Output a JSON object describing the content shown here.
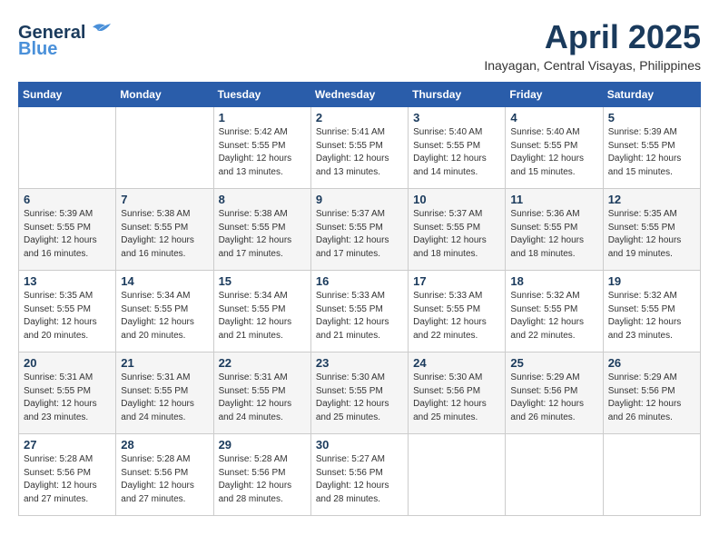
{
  "logo": {
    "line1": "General",
    "line2": "Blue"
  },
  "title": "April 2025",
  "location": "Inayagan, Central Visayas, Philippines",
  "days_of_week": [
    "Sunday",
    "Monday",
    "Tuesday",
    "Wednesday",
    "Thursday",
    "Friday",
    "Saturday"
  ],
  "weeks": [
    [
      {
        "day": "",
        "info": ""
      },
      {
        "day": "",
        "info": ""
      },
      {
        "day": "1",
        "info": "Sunrise: 5:42 AM\nSunset: 5:55 PM\nDaylight: 12 hours and 13 minutes."
      },
      {
        "day": "2",
        "info": "Sunrise: 5:41 AM\nSunset: 5:55 PM\nDaylight: 12 hours and 13 minutes."
      },
      {
        "day": "3",
        "info": "Sunrise: 5:40 AM\nSunset: 5:55 PM\nDaylight: 12 hours and 14 minutes."
      },
      {
        "day": "4",
        "info": "Sunrise: 5:40 AM\nSunset: 5:55 PM\nDaylight: 12 hours and 15 minutes."
      },
      {
        "day": "5",
        "info": "Sunrise: 5:39 AM\nSunset: 5:55 PM\nDaylight: 12 hours and 15 minutes."
      }
    ],
    [
      {
        "day": "6",
        "info": "Sunrise: 5:39 AM\nSunset: 5:55 PM\nDaylight: 12 hours and 16 minutes."
      },
      {
        "day": "7",
        "info": "Sunrise: 5:38 AM\nSunset: 5:55 PM\nDaylight: 12 hours and 16 minutes."
      },
      {
        "day": "8",
        "info": "Sunrise: 5:38 AM\nSunset: 5:55 PM\nDaylight: 12 hours and 17 minutes."
      },
      {
        "day": "9",
        "info": "Sunrise: 5:37 AM\nSunset: 5:55 PM\nDaylight: 12 hours and 17 minutes."
      },
      {
        "day": "10",
        "info": "Sunrise: 5:37 AM\nSunset: 5:55 PM\nDaylight: 12 hours and 18 minutes."
      },
      {
        "day": "11",
        "info": "Sunrise: 5:36 AM\nSunset: 5:55 PM\nDaylight: 12 hours and 18 minutes."
      },
      {
        "day": "12",
        "info": "Sunrise: 5:35 AM\nSunset: 5:55 PM\nDaylight: 12 hours and 19 minutes."
      }
    ],
    [
      {
        "day": "13",
        "info": "Sunrise: 5:35 AM\nSunset: 5:55 PM\nDaylight: 12 hours and 20 minutes."
      },
      {
        "day": "14",
        "info": "Sunrise: 5:34 AM\nSunset: 5:55 PM\nDaylight: 12 hours and 20 minutes."
      },
      {
        "day": "15",
        "info": "Sunrise: 5:34 AM\nSunset: 5:55 PM\nDaylight: 12 hours and 21 minutes."
      },
      {
        "day": "16",
        "info": "Sunrise: 5:33 AM\nSunset: 5:55 PM\nDaylight: 12 hours and 21 minutes."
      },
      {
        "day": "17",
        "info": "Sunrise: 5:33 AM\nSunset: 5:55 PM\nDaylight: 12 hours and 22 minutes."
      },
      {
        "day": "18",
        "info": "Sunrise: 5:32 AM\nSunset: 5:55 PM\nDaylight: 12 hours and 22 minutes."
      },
      {
        "day": "19",
        "info": "Sunrise: 5:32 AM\nSunset: 5:55 PM\nDaylight: 12 hours and 23 minutes."
      }
    ],
    [
      {
        "day": "20",
        "info": "Sunrise: 5:31 AM\nSunset: 5:55 PM\nDaylight: 12 hours and 23 minutes."
      },
      {
        "day": "21",
        "info": "Sunrise: 5:31 AM\nSunset: 5:55 PM\nDaylight: 12 hours and 24 minutes."
      },
      {
        "day": "22",
        "info": "Sunrise: 5:31 AM\nSunset: 5:55 PM\nDaylight: 12 hours and 24 minutes."
      },
      {
        "day": "23",
        "info": "Sunrise: 5:30 AM\nSunset: 5:55 PM\nDaylight: 12 hours and 25 minutes."
      },
      {
        "day": "24",
        "info": "Sunrise: 5:30 AM\nSunset: 5:56 PM\nDaylight: 12 hours and 25 minutes."
      },
      {
        "day": "25",
        "info": "Sunrise: 5:29 AM\nSunset: 5:56 PM\nDaylight: 12 hours and 26 minutes."
      },
      {
        "day": "26",
        "info": "Sunrise: 5:29 AM\nSunset: 5:56 PM\nDaylight: 12 hours and 26 minutes."
      }
    ],
    [
      {
        "day": "27",
        "info": "Sunrise: 5:28 AM\nSunset: 5:56 PM\nDaylight: 12 hours and 27 minutes."
      },
      {
        "day": "28",
        "info": "Sunrise: 5:28 AM\nSunset: 5:56 PM\nDaylight: 12 hours and 27 minutes."
      },
      {
        "day": "29",
        "info": "Sunrise: 5:28 AM\nSunset: 5:56 PM\nDaylight: 12 hours and 28 minutes."
      },
      {
        "day": "30",
        "info": "Sunrise: 5:27 AM\nSunset: 5:56 PM\nDaylight: 12 hours and 28 minutes."
      },
      {
        "day": "",
        "info": ""
      },
      {
        "day": "",
        "info": ""
      },
      {
        "day": "",
        "info": ""
      }
    ]
  ]
}
